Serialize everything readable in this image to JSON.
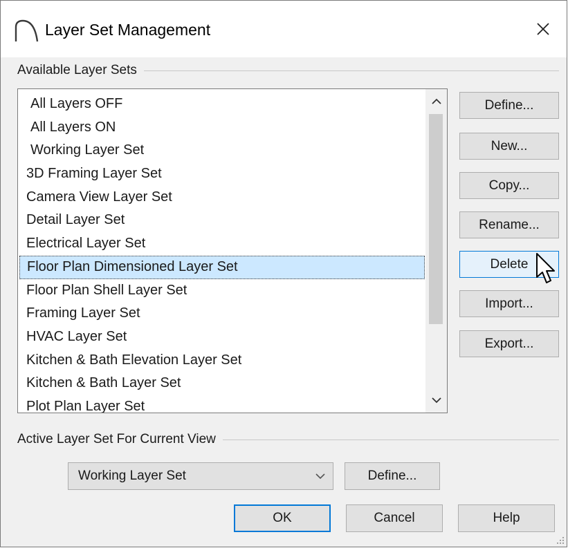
{
  "window": {
    "title": "Layer Set Management",
    "close_label": "×"
  },
  "available": {
    "group_label": "Available Layer Sets",
    "items": [
      {
        "label": "All Layers OFF",
        "indent": true
      },
      {
        "label": "All Layers ON",
        "indent": true
      },
      {
        "label": "Working Layer Set",
        "indent": true
      },
      {
        "label": "3D Framing Layer Set",
        "indent": false
      },
      {
        "label": "Camera View Layer Set",
        "indent": false
      },
      {
        "label": "Detail Layer Set",
        "indent": false
      },
      {
        "label": "Electrical Layer Set",
        "indent": false
      },
      {
        "label": "Floor Plan Dimensioned Layer Set",
        "indent": false,
        "selected": true
      },
      {
        "label": "Floor Plan Shell Layer Set",
        "indent": false
      },
      {
        "label": "Framing Layer Set",
        "indent": false
      },
      {
        "label": "HVAC Layer Set",
        "indent": false
      },
      {
        "label": "Kitchen & Bath Elevation Layer Set",
        "indent": false
      },
      {
        "label": "Kitchen & Bath Layer Set",
        "indent": false
      },
      {
        "label": "Plot Plan Layer Set",
        "indent": false
      }
    ]
  },
  "side_buttons": {
    "define": "Define...",
    "new": "New...",
    "copy": "Copy...",
    "rename": "Rename...",
    "delete": "Delete",
    "import": "Import...",
    "export": "Export..."
  },
  "active": {
    "group_label": "Active Layer Set For Current View",
    "selected_value": "Working Layer Set",
    "define_label": "Define..."
  },
  "footer": {
    "ok": "OK",
    "cancel": "Cancel",
    "help": "Help"
  },
  "colors": {
    "selection": "#cce8ff",
    "accent": "#0078d7",
    "button_face": "#e1e1e1"
  },
  "icons": {
    "app": "arch-icon",
    "close": "close-icon",
    "scroll_up": "chevron-up-icon",
    "scroll_down": "chevron-down-icon",
    "combo": "chevron-down-icon",
    "cursor": "mouse-pointer-icon",
    "grip": "resize-grip-icon"
  }
}
